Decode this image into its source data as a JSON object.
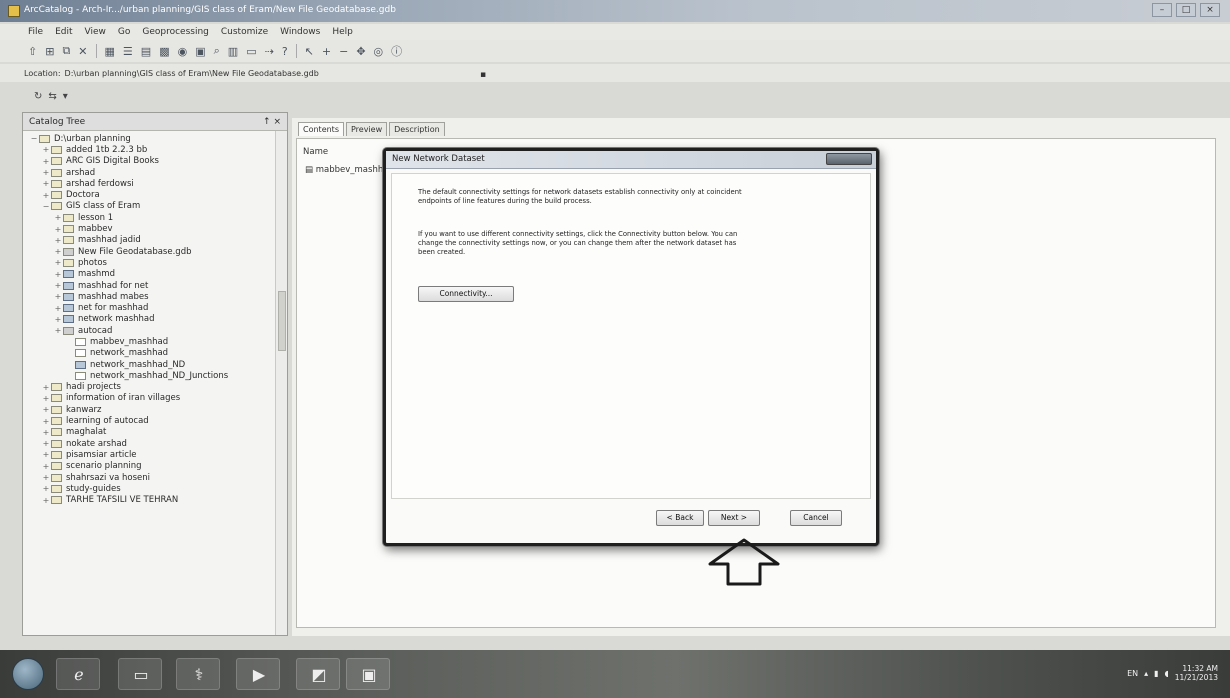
{
  "window": {
    "title": "ArcCatalog - Arch-Ir.../urban planning/GIS class of Eram/New File Geodatabase.gdb"
  },
  "menu": [
    "File",
    "Edit",
    "View",
    "Go",
    "Geoprocessing",
    "Customize",
    "Windows",
    "Help"
  ],
  "location": {
    "label": "Location:",
    "value": "D:\\urban planning\\GIS class of Eram\\New File Geodatabase.gdb"
  },
  "catalog": {
    "title": "Catalog Tree",
    "controls": "↑ ×",
    "tree": [
      {
        "label": "D:\\urban planning",
        "depth": 0,
        "exp": "−",
        "icon": "folder"
      },
      {
        "label": "added 1tb 2.2.3 bb",
        "depth": 1,
        "exp": "+",
        "icon": "folder"
      },
      {
        "label": "ARC GIS Digital Books",
        "depth": 1,
        "exp": "+",
        "icon": "folder"
      },
      {
        "label": "arshad",
        "depth": 1,
        "exp": "+",
        "icon": "folder"
      },
      {
        "label": "arshad ferdowsi",
        "depth": 1,
        "exp": "+",
        "icon": "folder"
      },
      {
        "label": "Doctora",
        "depth": 1,
        "exp": "+",
        "icon": "folder"
      },
      {
        "label": "GIS class of Eram",
        "depth": 1,
        "exp": "−",
        "icon": "folder"
      },
      {
        "label": "lesson 1",
        "depth": 2,
        "exp": "+",
        "icon": "folder"
      },
      {
        "label": "mabbev",
        "depth": 2,
        "exp": "+",
        "icon": "folder"
      },
      {
        "label": "mashhad jadid",
        "depth": 2,
        "exp": "+",
        "icon": "folder"
      },
      {
        "label": "New File Geodatabase.gdb",
        "depth": 2,
        "exp": "+",
        "icon": "db"
      },
      {
        "label": "photos",
        "depth": 2,
        "exp": "+",
        "icon": "folder"
      },
      {
        "label": "mashmd",
        "depth": 2,
        "exp": "+",
        "icon": "net"
      },
      {
        "label": "mashhad for net",
        "depth": 2,
        "exp": "+",
        "icon": "net"
      },
      {
        "label": "mashhad mabes",
        "depth": 2,
        "exp": "+",
        "icon": "net"
      },
      {
        "label": "net for mashhad",
        "depth": 2,
        "exp": "+",
        "icon": "net"
      },
      {
        "label": "network mashhad",
        "depth": 2,
        "exp": "+",
        "icon": "net"
      },
      {
        "label": "autocad",
        "depth": 2,
        "exp": "+",
        "icon": "db"
      },
      {
        "label": "mabbev_mashhad",
        "depth": 3,
        "exp": "",
        "icon": "doc"
      },
      {
        "label": "network_mashhad",
        "depth": 3,
        "exp": "",
        "icon": "doc"
      },
      {
        "label": "network_mashhad_ND",
        "depth": 3,
        "exp": "",
        "icon": "net"
      },
      {
        "label": "network_mashhad_ND_Junctions",
        "depth": 3,
        "exp": "",
        "icon": "doc"
      },
      {
        "label": "hadi projects",
        "depth": 1,
        "exp": "+",
        "icon": "folder"
      },
      {
        "label": "information of iran villages",
        "depth": 1,
        "exp": "+",
        "icon": "folder"
      },
      {
        "label": "kanwarz",
        "depth": 1,
        "exp": "+",
        "icon": "folder"
      },
      {
        "label": "learning of autocad",
        "depth": 1,
        "exp": "+",
        "icon": "folder"
      },
      {
        "label": "maghalat",
        "depth": 1,
        "exp": "+",
        "icon": "folder"
      },
      {
        "label": "nokate arshad",
        "depth": 1,
        "exp": "+",
        "icon": "folder"
      },
      {
        "label": "pisamsiar article",
        "depth": 1,
        "exp": "+",
        "icon": "folder"
      },
      {
        "label": "scenario planning",
        "depth": 1,
        "exp": "+",
        "icon": "folder"
      },
      {
        "label": "shahrsazi va hoseni",
        "depth": 1,
        "exp": "+",
        "icon": "folder"
      },
      {
        "label": "study-guides",
        "depth": 1,
        "exp": "+",
        "icon": "folder"
      },
      {
        "label": "TARHE TAFSILI VE TEHRAN",
        "depth": 1,
        "exp": "+",
        "icon": "folder"
      }
    ]
  },
  "content": {
    "tabs": [
      "Contents",
      "Preview",
      "Description"
    ],
    "column_name": "Name",
    "first_row": "mabbev_mashhad"
  },
  "dialog": {
    "title": "New Network Dataset",
    "paragraph1": "The default connectivity settings for network datasets establish connectivity only at coincident endpoints of line features during the build process.",
    "paragraph2": "If you want to use different connectivity settings, click the Connectivity button below. You can change the connectivity settings now, or you can change them after the network dataset has been created.",
    "connectivity_label": "Connectivity...",
    "back_label": "< Back",
    "next_label": "Next >",
    "cancel_label": "Cancel"
  },
  "taskbar": {
    "lang": "EN",
    "time": "11:32 AM",
    "date": "11/21/2013"
  }
}
